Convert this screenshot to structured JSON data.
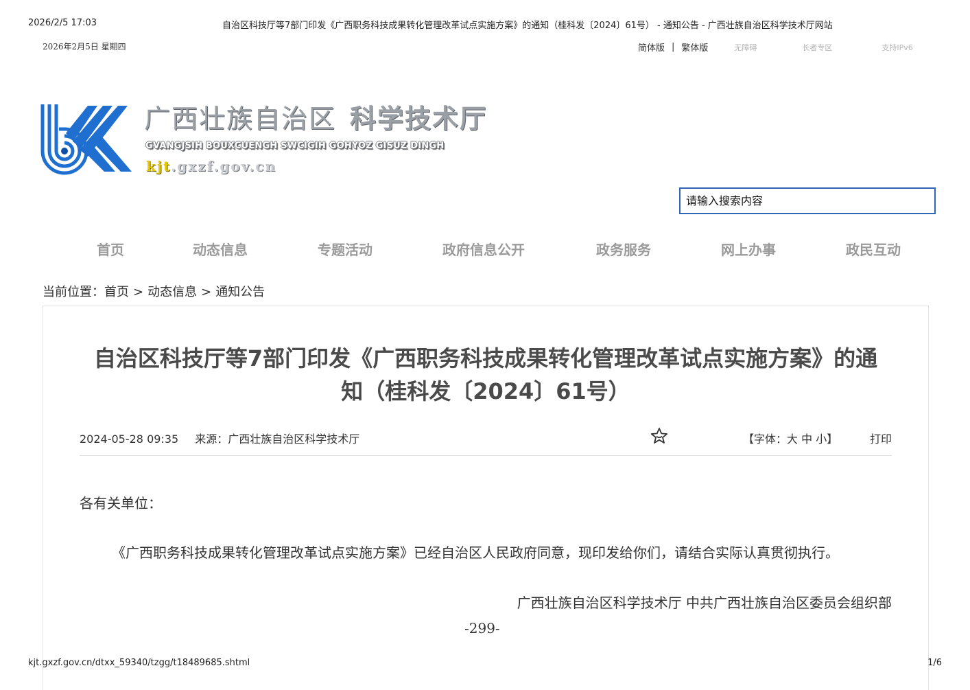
{
  "print": {
    "datetime": "2026/2/5 17:03",
    "window_title": "自治区科技厅等7部门印发《广西职务科技成果转化管理改革试点实施方案》的通知（桂科发〔2024〕61号） - 通知公告 - 广西壮族自治区科学技术厅网站",
    "url": "kjt.gxzf.gov.cn/dtxx_59340/tzgg/t18489685.shtml",
    "page": "1/6"
  },
  "topbar": {
    "date": "2026年2月5日  星期四",
    "simplified": "简体版",
    "separator": "|",
    "traditional": "繁体版",
    "accessibility": "无障碍",
    "elder": "长者专区",
    "ipv6": "支持IPv6"
  },
  "logo": {
    "cn_region": "广西壮族自治区",
    "cn_dept": "科学技术厅",
    "en": "GVANGJSIH BOUXCUENGH SWCIGIH GOHYOZ GISUZ DINGH",
    "url_prefix": "kjt",
    "url_rest": ".gxzf.gov.cn",
    "colors": {
      "blue": "#1e6fd0",
      "dark_blue": "#0f4fa8"
    }
  },
  "search": {
    "placeholder": "请输入搜索内容"
  },
  "nav": {
    "items": [
      "首页",
      "动态信息",
      "专题活动",
      "政府信息公开",
      "政务服务",
      "网上办事",
      "政民互动"
    ]
  },
  "breadcrumb": {
    "label": "当前位置：",
    "home": "首页",
    "sep": ">",
    "level1": "动态信息",
    "level2": "通知公告"
  },
  "article": {
    "title_line1": "自治区科技厅等7部门印发《广西职务科技成果转化管理改革试点实施方案》的通",
    "title_line2": "知（桂科发〔2024〕61号）",
    "date": "2024-05-28 09:35",
    "source": "来源：广西壮族自治区科学技术厅",
    "fav_icon": "star-icon",
    "font_open": "【字体：",
    "font_large": "大",
    "font_medium": "中",
    "font_small": "小",
    "font_close": "】",
    "print": "打印",
    "salutation": "各有关单位：",
    "paragraph": "《广西职务科技成果转化管理改革试点实施方案》已经自治区人民政府同意，现印发给你们，请结合实际认真贯彻执行。",
    "signatories": "广西壮族自治区科学技术厅  中共广西壮族自治区委员会组织部",
    "page_number": "-299-"
  }
}
